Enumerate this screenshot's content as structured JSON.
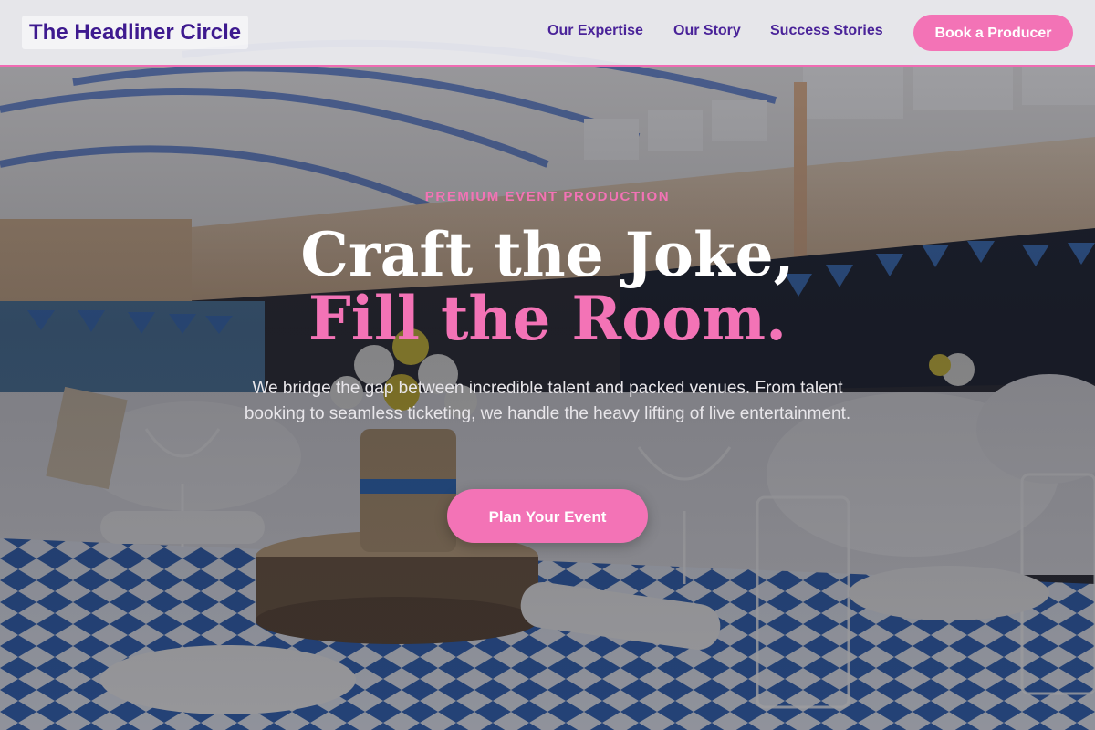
{
  "nav": {
    "logo": "The Headliner Circle",
    "links": [
      "Our Expertise",
      "Our Story",
      "Success Stories"
    ],
    "cta": "Book a Producer"
  },
  "hero": {
    "eyebrow": "PREMIUM EVENT PRODUCTION",
    "headline_line1": "Craft the Joke,",
    "headline_line2": "Fill the Room.",
    "subtext": "We bridge the gap between incredible talent and packed venues. From talent booking to seamless ticketing, we handle the heavy lifting of live entertainment.",
    "cta": "Plan Your Event",
    "background_description_icon": "banquet-hall-photo"
  },
  "colors": {
    "accent_pink": "#f373b6",
    "brand_purple": "#3e1a8f",
    "nav_link_purple": "#4a2399",
    "nav_background": "#ececf0"
  }
}
